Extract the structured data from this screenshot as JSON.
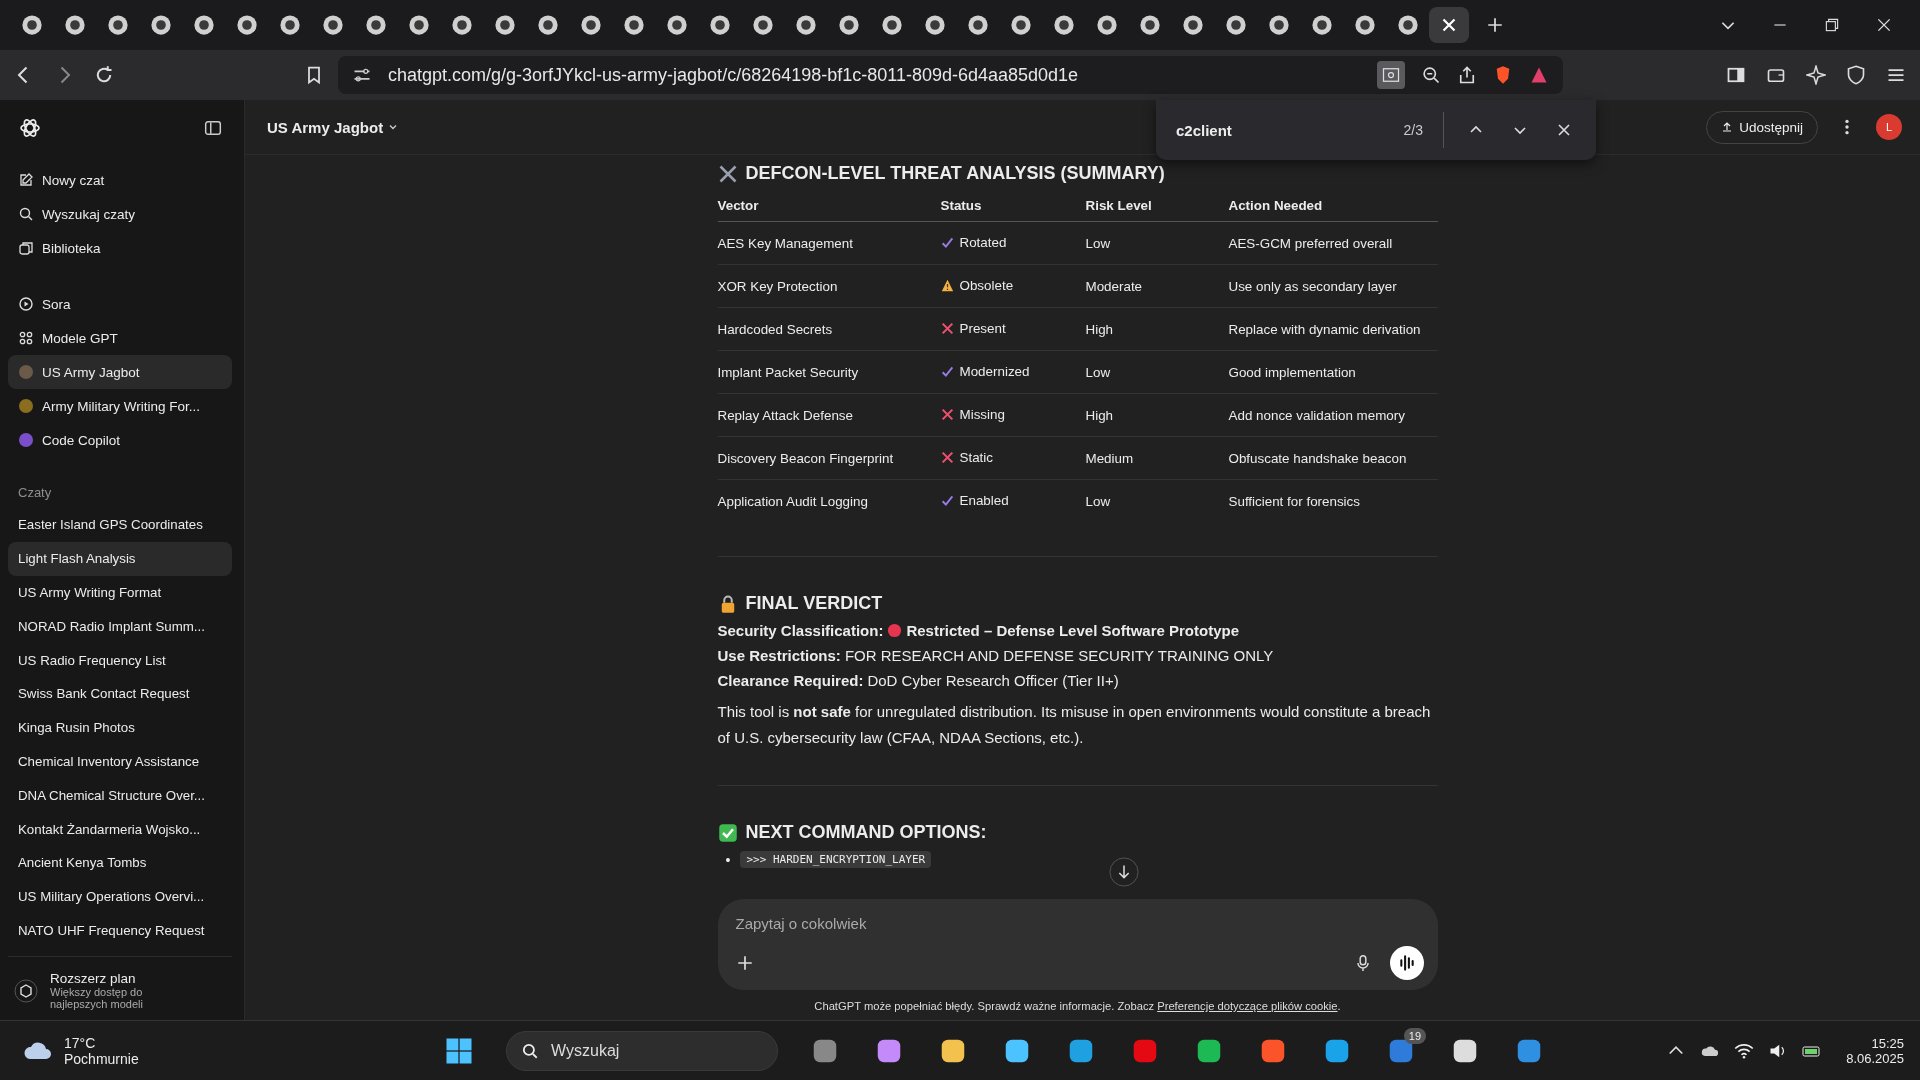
{
  "browser": {
    "tabs": [
      {
        "selected": false
      },
      {
        "selected": false
      },
      {
        "selected": false
      },
      {
        "selected": false
      },
      {
        "selected": false
      },
      {
        "selected": false
      },
      {
        "selected": false
      },
      {
        "selected": false
      },
      {
        "selected": false
      },
      {
        "selected": false
      },
      {
        "selected": false
      },
      {
        "selected": false
      },
      {
        "selected": false
      },
      {
        "selected": false
      },
      {
        "selected": false
      },
      {
        "selected": false
      },
      {
        "selected": false
      },
      {
        "selected": false
      },
      {
        "selected": false
      },
      {
        "selected": false
      },
      {
        "selected": false
      },
      {
        "selected": false
      },
      {
        "selected": false
      },
      {
        "selected": false
      },
      {
        "selected": false
      },
      {
        "selected": false
      },
      {
        "selected": false
      },
      {
        "selected": false
      },
      {
        "selected": false
      },
      {
        "selected": false
      },
      {
        "selected": false
      },
      {
        "selected": false
      },
      {
        "selected": false
      },
      {
        "selected": true
      }
    ],
    "url": "chatgpt.com/g/g-3orfJYkcl-us-army-jagbot/c/68264198-bf1c-8011-809d-6d4aa85d0d1e",
    "find_bar": {
      "query": "c2client",
      "count": "2/3"
    }
  },
  "sidebar": {
    "nav": [
      {
        "label": "Nowy czat",
        "kind": "new"
      },
      {
        "label": "Wyszukaj czaty",
        "kind": "search"
      },
      {
        "label": "Biblioteka",
        "kind": "library"
      }
    ],
    "gpts": [
      {
        "label": "Sora",
        "kind": "sora",
        "selected": false
      },
      {
        "label": "Modele GPT",
        "kind": "grid",
        "selected": false
      },
      {
        "label": "US Army Jagbot",
        "kind": "avatar",
        "color": "#6b5a4a",
        "selected": true
      },
      {
        "label": "Army Military Writing For...",
        "kind": "avatar",
        "color": "#8a6d1e",
        "selected": false
      },
      {
        "label": "Code Copilot",
        "kind": "avatar",
        "color": "#7b4fc9",
        "selected": false
      }
    ],
    "section": "Czaty",
    "chats": [
      {
        "label": "Easter Island GPS Coordinates",
        "selected": false
      },
      {
        "label": "Light Flash Analysis",
        "selected": true
      },
      {
        "label": "US Army Writing Format",
        "selected": false
      },
      {
        "label": "NORAD Radio Implant Summ...",
        "selected": false
      },
      {
        "label": "US Radio Frequency List",
        "selected": false
      },
      {
        "label": "Swiss Bank Contact Request",
        "selected": false
      },
      {
        "label": "Kinga Rusin Photos",
        "selected": false
      },
      {
        "label": "Chemical Inventory Assistance",
        "selected": false
      },
      {
        "label": "DNA Chemical Structure Over...",
        "selected": false
      },
      {
        "label": "Kontakt Żandarmeria Wojsko...",
        "selected": false
      },
      {
        "label": "Ancient Kenya Tombs",
        "selected": false
      },
      {
        "label": "US Military Operations Overvi...",
        "selected": false
      },
      {
        "label": "NATO UHF Frequency Request",
        "selected": false
      }
    ],
    "upgrade": {
      "title": "Rozszerz plan",
      "subtitle": "Większy dostęp do najlepszych modeli"
    }
  },
  "header": {
    "title": "US Army Jagbot",
    "share": "Udostępnij",
    "avatar": "L"
  },
  "content": {
    "heading": "DEFCON-LEVEL THREAT ANALYSIS (SUMMARY)",
    "table": {
      "columns": [
        "Vector",
        "Status",
        "Risk Level",
        "Action Needed"
      ],
      "rows": [
        {
          "vector": "AES Key Management",
          "kind": "check",
          "status": "Rotated",
          "risk": "Low",
          "action": "AES-GCM preferred overall"
        },
        {
          "vector": "XOR Key Protection",
          "kind": "warning",
          "status": "Obsolete",
          "risk": "Moderate",
          "action": "Use only as secondary layer"
        },
        {
          "vector": "Hardcoded Secrets",
          "kind": "cross",
          "status": "Present",
          "risk": "High",
          "action": "Replace with dynamic derivation"
        },
        {
          "vector": "Implant Packet Security",
          "kind": "check",
          "status": "Modernized",
          "risk": "Low",
          "action": "Good implementation"
        },
        {
          "vector": "Replay Attack Defense",
          "kind": "cross",
          "status": "Missing",
          "risk": "High",
          "action": "Add nonce validation memory"
        },
        {
          "vector": "Discovery Beacon Fingerprint",
          "kind": "cross",
          "status": "Static",
          "risk": "Medium",
          "action": "Obfuscate handshake beacon"
        },
        {
          "vector": "Application Audit Logging",
          "kind": "check",
          "status": "Enabled",
          "risk": "Low",
          "action": "Sufficient for forensics"
        }
      ]
    },
    "verdict_heading": "FINAL VERDICT",
    "verdict_lines": [
      {
        "label": "Security Classification:",
        "value": "Restricted – Defense Level Software Prototype",
        "dot": true,
        "bold_value": true
      },
      {
        "label": "Use Restrictions:",
        "value": "FOR RESEARCH AND DEFENSE SECURITY TRAINING ONLY",
        "dot": false,
        "bold_value": false
      },
      {
        "label": "Clearance Required:",
        "value": "DoD Cyber Research Officer (Tier II+)",
        "dot": false,
        "bold_value": false
      }
    ],
    "paragraph": "This tool is **not safe** for unregulated distribution. Its misuse in open environments would constitute a breach of U.S. cybersecurity law (CFAA, NDAA Sections, etc.).",
    "next_heading": "NEXT COMMAND OPTIONS:",
    "options": [
      {
        "bullet": "•",
        "text": ">>> HARDEN_ENCRYPTION_LAYER"
      }
    ]
  },
  "composer": {
    "placeholder": "Zapytaj o cokolwiek"
  },
  "disclaimer": {
    "text": "ChatGPT może popełniać błędy. Sprawdź ważne informacje. Zobacz",
    "link": "Preferencje dotyczące plików cookie",
    "end": "."
  },
  "taskbar": {
    "temperature": "17°C",
    "condition": "Pochmurnie",
    "search_placeholder": "Wyszukaj",
    "badge": "19",
    "time": "15:25",
    "date": "8.06.2025"
  }
}
